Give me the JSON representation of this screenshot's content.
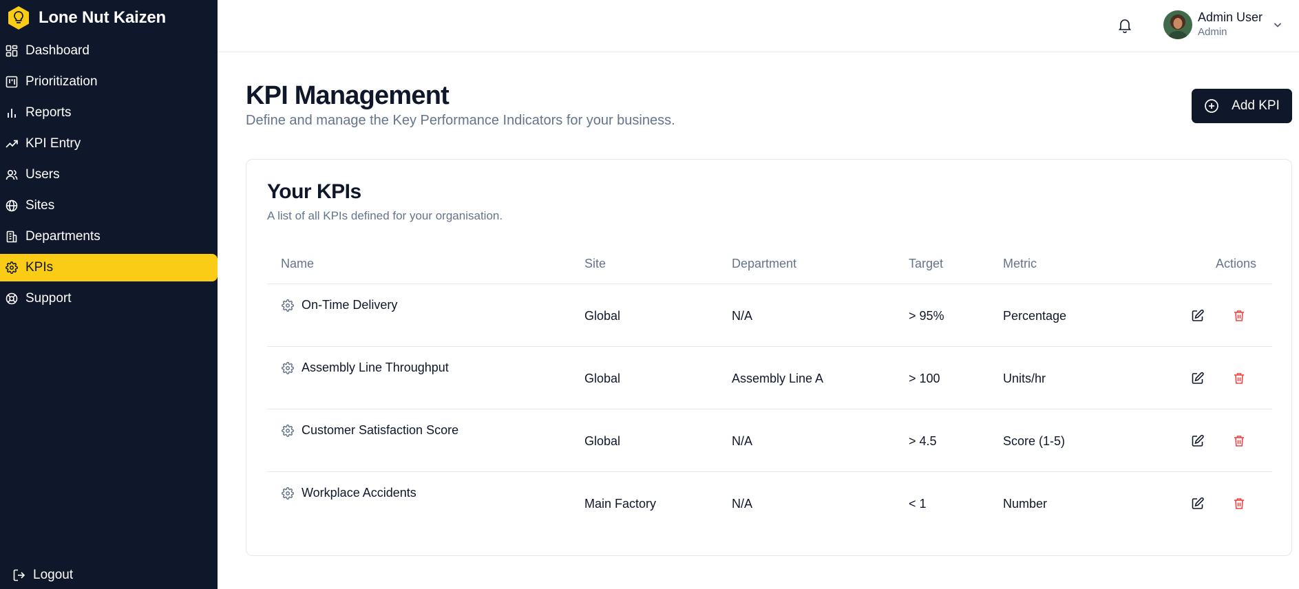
{
  "app": {
    "name": "Lone Nut Kaizen",
    "logo_icon": "lightbulb-icon",
    "accent": "#facc15",
    "sidebar_bg": "#0f172a"
  },
  "sidebar": {
    "items": [
      {
        "label": "Dashboard",
        "icon": "dashboard-icon"
      },
      {
        "label": "Prioritization",
        "icon": "kanban-icon"
      },
      {
        "label": "Reports",
        "icon": "bar-chart-icon"
      },
      {
        "label": "KPI Entry",
        "icon": "trending-up-icon"
      },
      {
        "label": "Users",
        "icon": "users-icon"
      },
      {
        "label": "Sites",
        "icon": "globe-icon"
      },
      {
        "label": "Departments",
        "icon": "building-icon"
      },
      {
        "label": "KPIs",
        "icon": "gear-icon",
        "active": true
      },
      {
        "label": "Support",
        "icon": "lifebuoy-icon"
      }
    ],
    "logout_label": "Logout"
  },
  "header": {
    "user_name": "Admin User",
    "user_role": "Admin"
  },
  "page": {
    "title": "KPI Management",
    "subtitle": "Define and manage the Key Performance Indicators for your business.",
    "add_button": "Add KPI"
  },
  "card": {
    "title": "Your KPIs",
    "subtitle": "A list of all KPIs defined for your organisation."
  },
  "table": {
    "columns": [
      "Name",
      "Site",
      "Department",
      "Target",
      "Metric",
      "Actions"
    ],
    "rows": [
      {
        "name": "On-Time Delivery",
        "site": "Global",
        "department": "N/A",
        "target": "> 95%",
        "metric": "Percentage"
      },
      {
        "name": "Assembly Line Throughput",
        "site": "Global",
        "department": "Assembly Line A",
        "target": "> 100",
        "metric": "Units/hr"
      },
      {
        "name": "Customer Satisfaction Score",
        "site": "Global",
        "department": "N/A",
        "target": "> 4.5",
        "metric": "Score (1-5)"
      },
      {
        "name": "Workplace Accidents",
        "site": "Main Factory",
        "department": "N/A",
        "target": "< 1",
        "metric": "Number"
      }
    ],
    "delete_color": "#ef4444"
  }
}
